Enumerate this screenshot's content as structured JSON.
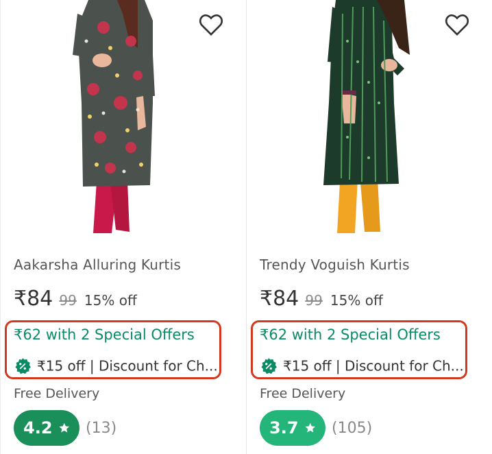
{
  "products": [
    {
      "title": "Aakarsha Alluring Kurtis",
      "price": "₹84",
      "mrp": "99",
      "discount": "15% off",
      "offer_price_line": "₹62 with 2 Special Offers",
      "offer_detail": "₹15 off | Discount for Ch...",
      "delivery": "Free Delivery",
      "rating": "4.2",
      "rating_count": "(13)",
      "rating_color": "#1a8f5a",
      "wishlist_icon": "heart-outline-icon"
    },
    {
      "title": "Trendy Voguish Kurtis",
      "price": "₹84",
      "mrp": "99",
      "discount": "15% off",
      "offer_price_line": "₹62 with 2 Special Offers",
      "offer_detail": "₹15 off | Discount for Ch...",
      "delivery": "Free Delivery",
      "rating": "3.7",
      "rating_count": "(105)",
      "rating_color": "#23b57a",
      "wishlist_icon": "heart-outline-icon"
    }
  ],
  "colors": {
    "offer_text": "#0b8a66",
    "highlight_border": "#d0391f"
  }
}
